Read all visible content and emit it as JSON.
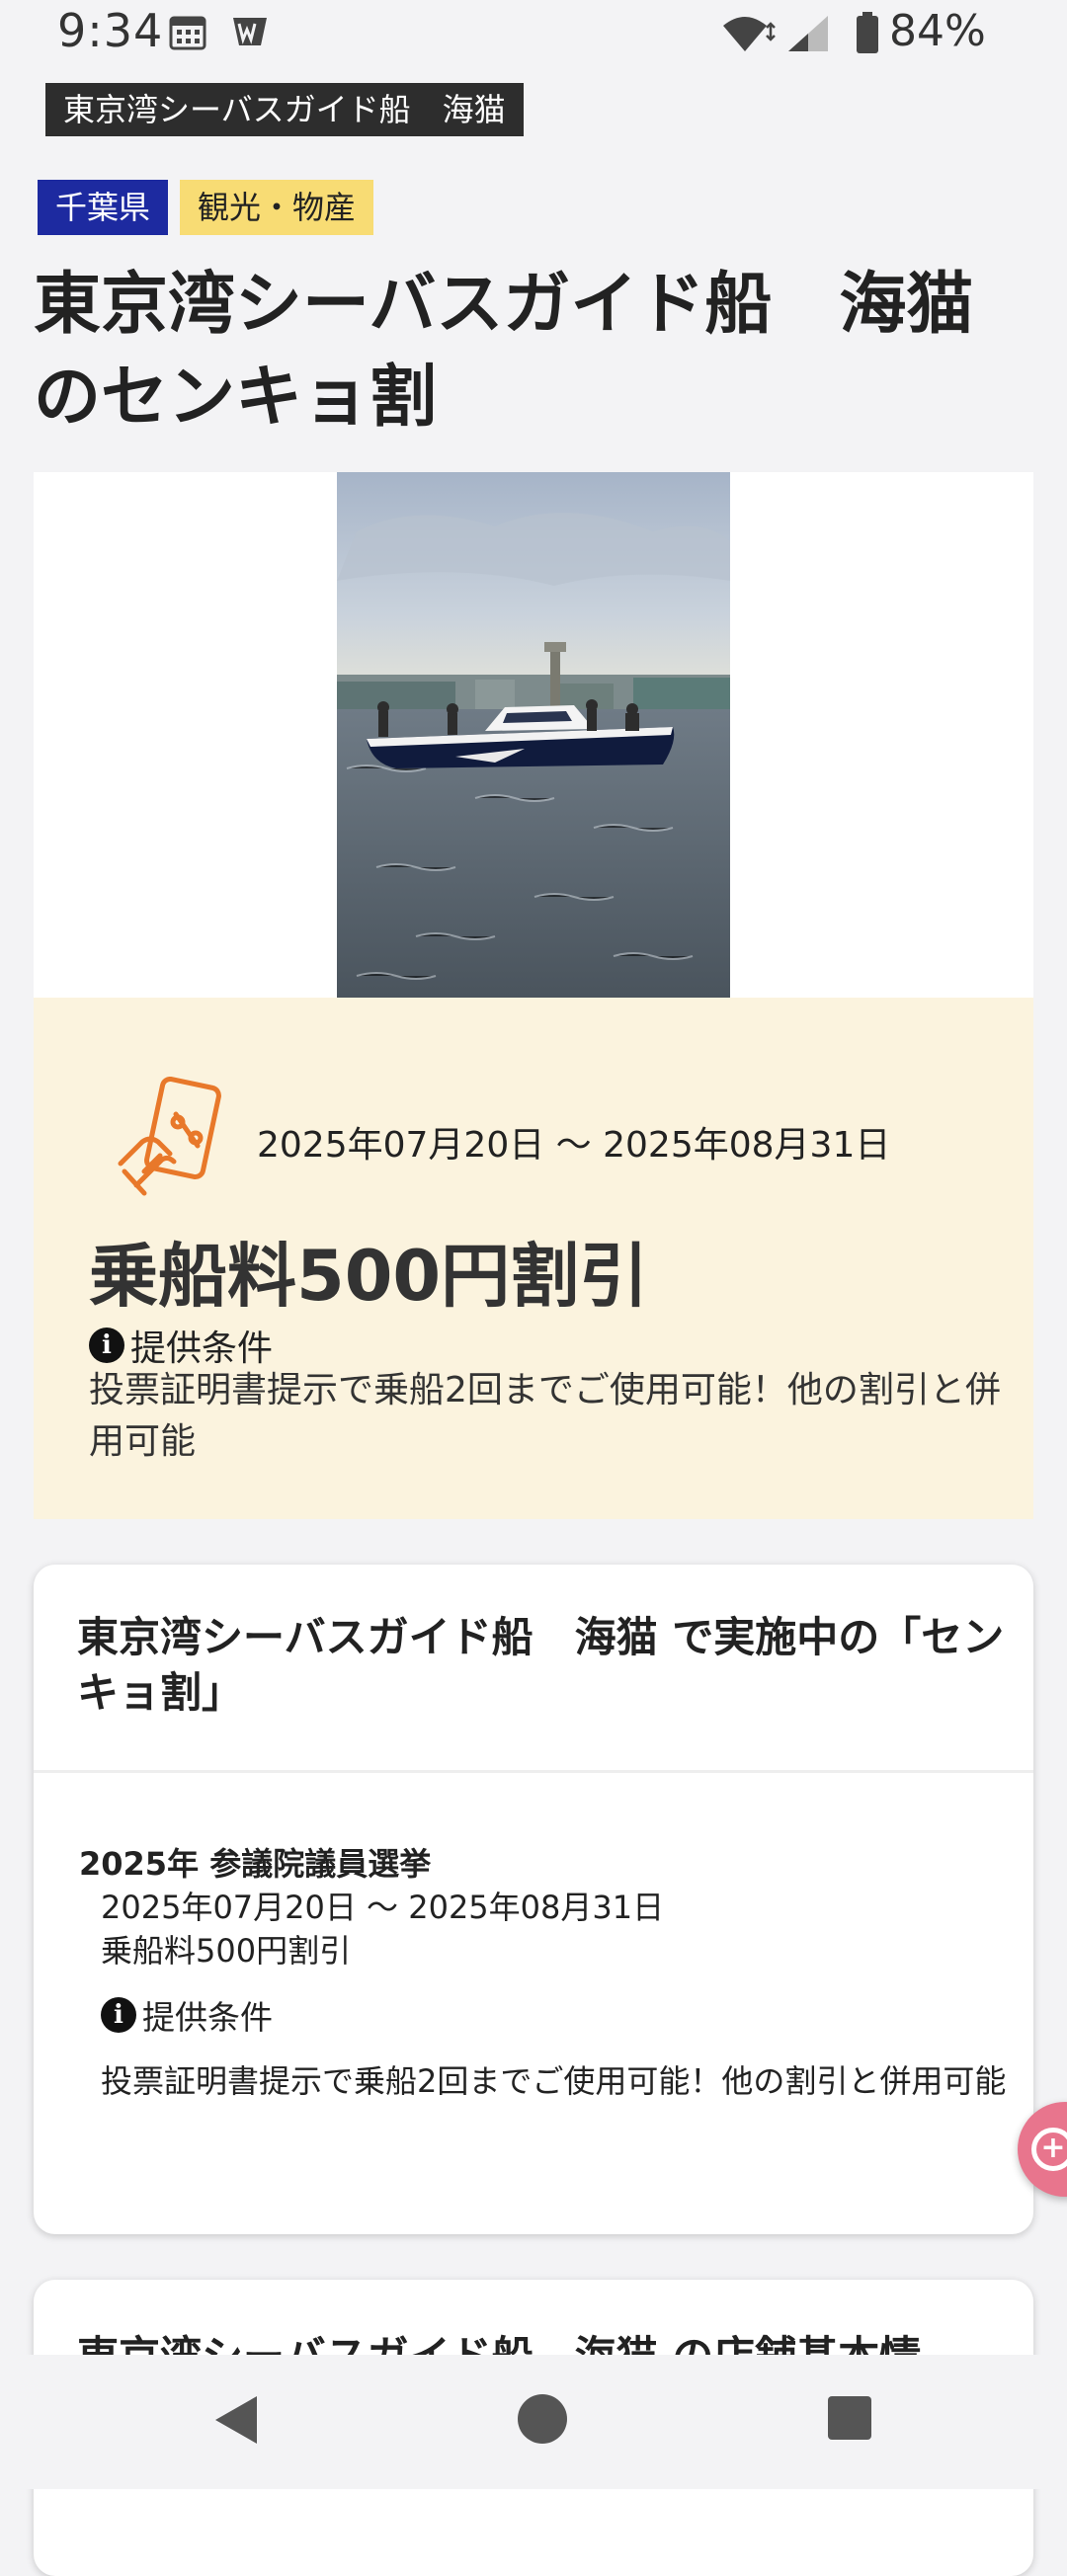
{
  "status_bar": {
    "time": "9:34",
    "battery_percent": "84%"
  },
  "header": {
    "title": "東京湾シーバスガイド船　海猫"
  },
  "tags": {
    "prefecture": "千葉県",
    "category": "観光・物産"
  },
  "page": {
    "title": "東京湾シーバスガイド船　海猫のセンキョ割"
  },
  "offer": {
    "period": "2025年07月20日 〜 2025年08月31日",
    "headline": "乗船料500円割引",
    "conditions_label": "提供条件",
    "conditions_text": "投票証明書提示で乗船2回までご使用可能！他の割引と併用可能"
  },
  "campaign_card": {
    "title": "東京湾シーバスガイド船　海猫 で実施中の「センキョ割」",
    "election": "2025年 参議院議員選挙",
    "period": "2025年07月20日 〜 2025年08月31日",
    "discount": "乗船料500円割引",
    "conditions_label": "提供条件",
    "conditions_text": "投票証明書提示で乗船2回までご使用可能！他の割引と併用可能"
  },
  "info_card": {
    "title": "東京湾シーバスガイド船　海猫 の店舗基本情"
  },
  "colors": {
    "prefecture_tag": "#1d2aa0",
    "category_tag": "#f8dc74",
    "offer_bg": "#fbf3de",
    "accent_orange": "#e8782a",
    "fab": "#e8758d"
  }
}
